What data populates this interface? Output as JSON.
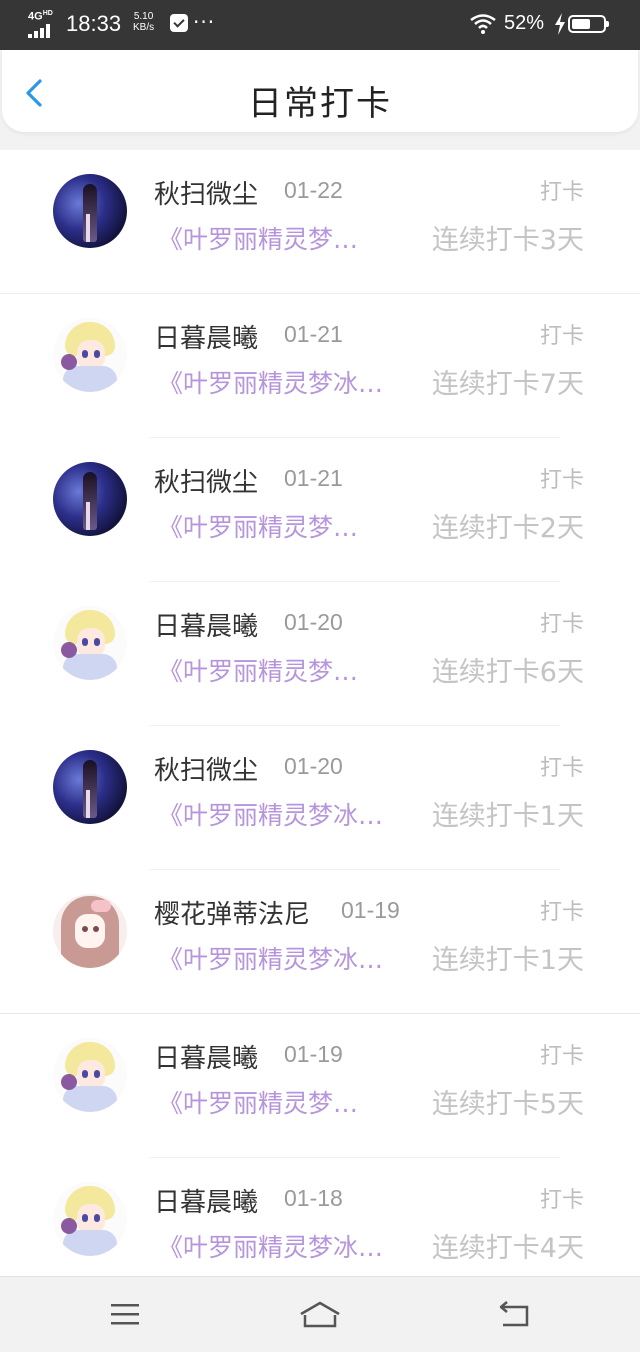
{
  "status_bar": {
    "network": "4G",
    "network_sup": "HD",
    "time": "18:33",
    "speed_value": "5.10",
    "speed_unit": "KB/s",
    "more": "···",
    "battery": "52%"
  },
  "header": {
    "title": "日常打卡",
    "back_icon": "chevron-left-icon"
  },
  "colors": {
    "accent": "#2a97e8",
    "book_title": "#b695dd",
    "muted": "#c4c4c4"
  },
  "entries": [
    {
      "name": "秋扫微尘",
      "date": "01-22",
      "action": "打卡",
      "book": "《叶罗丽精灵梦…",
      "streak": "连续打卡3天",
      "avatar": "dark"
    },
    {
      "name": "日暮晨曦",
      "date": "01-21",
      "action": "打卡",
      "book": "《叶罗丽精灵梦冰…",
      "streak": "连续打卡7天",
      "avatar": "moon"
    },
    {
      "name": "秋扫微尘",
      "date": "01-21",
      "action": "打卡",
      "book": "《叶罗丽精灵梦…",
      "streak": "连续打卡2天",
      "avatar": "dark"
    },
    {
      "name": "日暮晨曦",
      "date": "01-20",
      "action": "打卡",
      "book": "《叶罗丽精灵梦…",
      "streak": "连续打卡6天",
      "avatar": "moon"
    },
    {
      "name": "秋扫微尘",
      "date": "01-20",
      "action": "打卡",
      "book": "《叶罗丽精灵梦冰…",
      "streak": "连续打卡1天",
      "avatar": "dark"
    },
    {
      "name": "樱花弹蒂法尼",
      "date": "01-19",
      "action": "打卡",
      "book": "《叶罗丽精灵梦冰…",
      "streak": "连续打卡1天",
      "avatar": "pink"
    },
    {
      "name": "日暮晨曦",
      "date": "01-19",
      "action": "打卡",
      "book": "《叶罗丽精灵梦…",
      "streak": "连续打卡5天",
      "avatar": "moon"
    },
    {
      "name": "日暮晨曦",
      "date": "01-18",
      "action": "打卡",
      "book": "《叶罗丽精灵梦冰…",
      "streak": "连续打卡4天",
      "avatar": "moon"
    }
  ],
  "nav_bar": {
    "menu_icon": "menu-icon",
    "home_icon": "home-icon",
    "back_icon": "back-icon"
  }
}
